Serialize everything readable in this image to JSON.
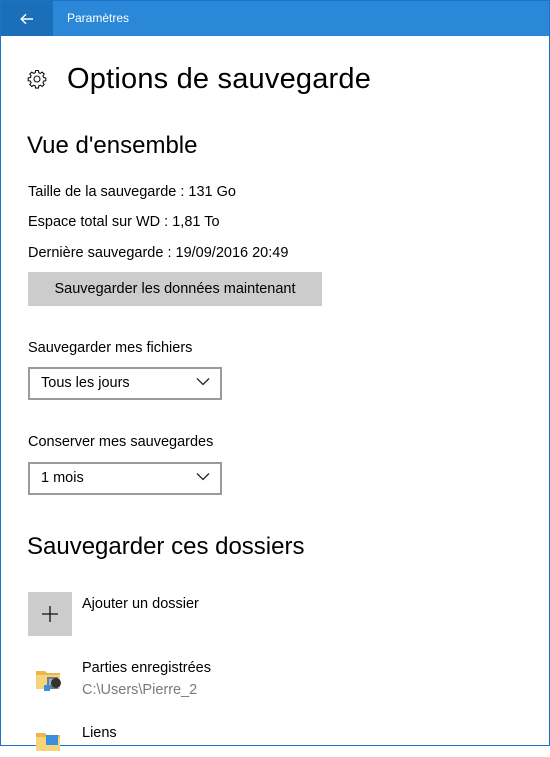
{
  "window": {
    "title": "Paramètres"
  },
  "header": {
    "title": "Options de sauvegarde",
    "icon": "gear-icon"
  },
  "overview": {
    "title": "Vue d'ensemble",
    "backup_size": "Taille de la sauvegarde : 131 Go",
    "total_space": "Espace total sur WD : 1,81 To",
    "last_backup": "Dernière sauvegarde : 19/09/2016 20:49",
    "backup_now_label": "Sauvegarder les données maintenant"
  },
  "frequency": {
    "label": "Sauvegarder mes fichiers",
    "selected": "Tous les jours"
  },
  "retention": {
    "label": "Conserver mes sauvegardes",
    "selected": "1 mois"
  },
  "folders": {
    "title": "Sauvegarder ces dossiers",
    "add_label": "Ajouter un dossier",
    "items": [
      {
        "name": "Parties enregistrées",
        "path": "C:\\Users\\Pierre_2"
      },
      {
        "name": "Liens",
        "path": ""
      }
    ]
  },
  "colors": {
    "accent": "#2b88d8",
    "accent_dark": "#1a6fb8",
    "button_gray": "#cccccc"
  }
}
